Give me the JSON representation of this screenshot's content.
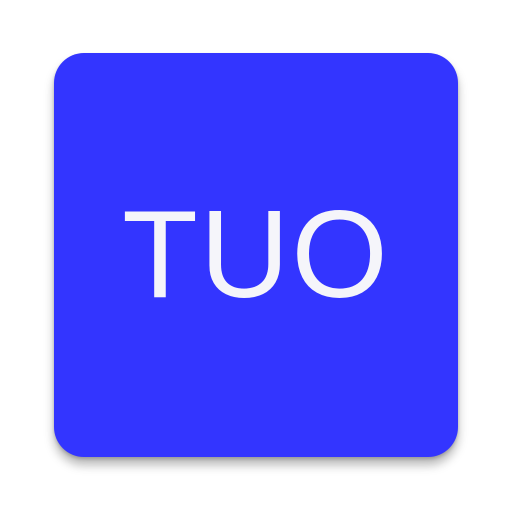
{
  "icon": {
    "label": "TUO",
    "background_color": "#3335ff",
    "text_color": "#f5f5fa"
  }
}
